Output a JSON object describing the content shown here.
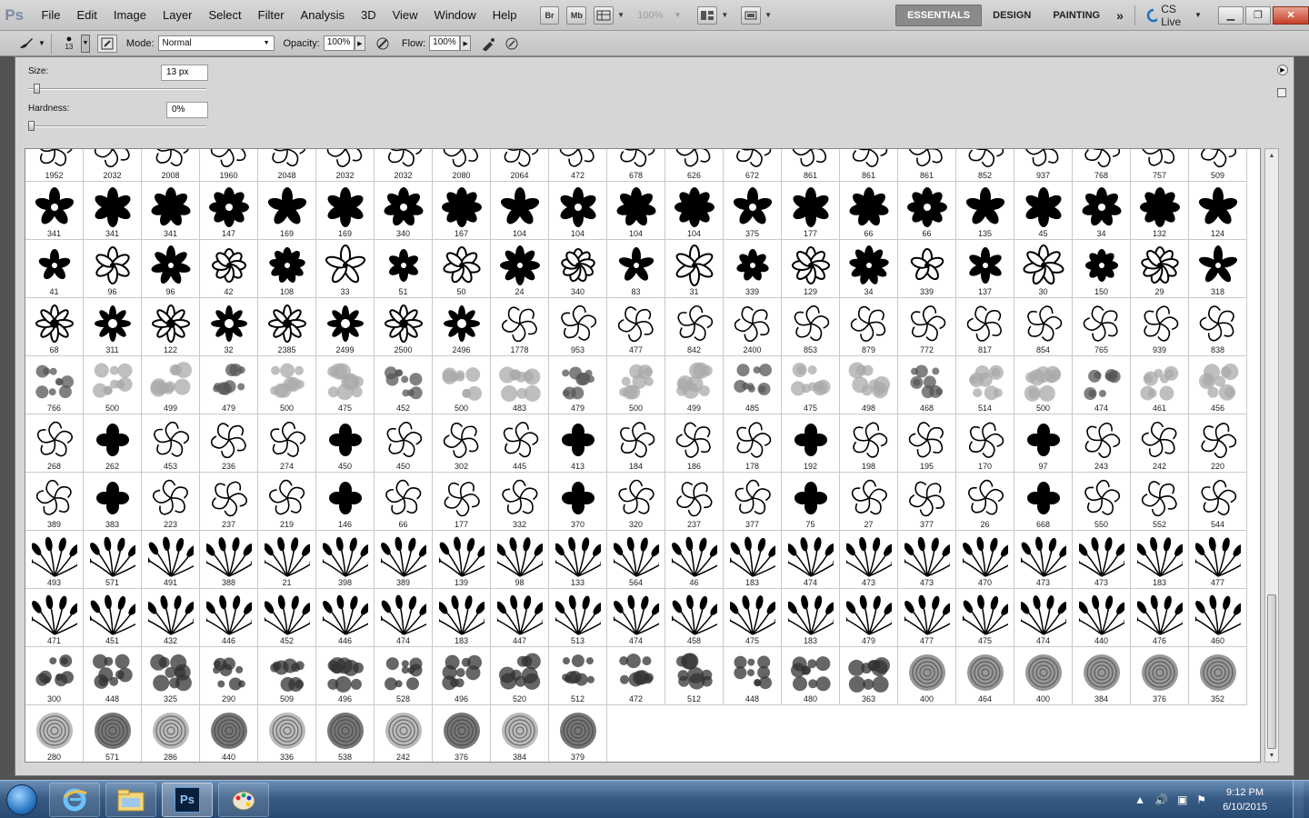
{
  "app": {
    "logo": "Ps"
  },
  "menu": [
    "File",
    "Edit",
    "Image",
    "Layer",
    "Select",
    "Filter",
    "Analysis",
    "3D",
    "View",
    "Window",
    "Help"
  ],
  "menubar_tools": {
    "bridge": "Br",
    "minibridge": "Mb",
    "zoom": "100%"
  },
  "workspaces": {
    "active": "ESSENTIALS",
    "items": [
      "ESSENTIALS",
      "DESIGN",
      "PAINTING"
    ]
  },
  "cslive": "CS Live",
  "options": {
    "mode_label": "Mode:",
    "mode_value": "Normal",
    "opacity_label": "Opacity:",
    "opacity_value": "100%",
    "flow_label": "Flow:",
    "flow_value": "100%",
    "brush_size_badge": "13"
  },
  "brush_panel": {
    "size_label": "Size:",
    "size_value": "13 px",
    "size_fraction": 0.03,
    "hardness_label": "Hardness:",
    "hardness_value": "0%",
    "hardness_fraction": 0.0
  },
  "brush_sizes": [
    1952,
    2032,
    2008,
    1960,
    2048,
    2032,
    2032,
    2080,
    2064,
    472,
    678,
    626,
    672,
    861,
    861,
    861,
    852,
    937,
    768,
    757,
    509,
    341,
    341,
    341,
    147,
    169,
    169,
    340,
    167,
    104,
    104,
    104,
    104,
    375,
    177,
    66,
    66,
    135,
    45,
    34,
    132,
    124,
    41,
    96,
    96,
    42,
    108,
    33,
    51,
    50,
    24,
    340,
    83,
    31,
    339,
    129,
    34,
    339,
    137,
    30,
    150,
    29,
    318,
    68,
    311,
    122,
    32,
    2385,
    2499,
    2500,
    2496,
    1778,
    953,
    477,
    842,
    2400,
    853,
    879,
    772,
    817,
    854,
    765,
    939,
    838,
    766,
    500,
    499,
    479,
    500,
    475,
    452,
    500,
    483,
    479,
    500,
    499,
    485,
    475,
    498,
    468,
    514,
    500,
    474,
    461,
    456,
    268,
    262,
    453,
    236,
    274,
    450,
    450,
    302,
    445,
    413,
    184,
    186,
    178,
    192,
    198,
    195,
    170,
    97,
    243,
    242,
    220,
    389,
    383,
    223,
    237,
    219,
    146,
    66,
    177,
    332,
    370,
    320,
    237,
    377,
    75,
    27,
    377,
    26,
    668,
    550,
    552,
    544,
    493,
    571,
    491,
    388,
    21,
    398,
    389,
    139,
    98,
    133,
    564,
    46,
    183,
    474,
    473,
    473,
    470,
    473,
    473,
    183,
    477,
    471,
    451,
    432,
    446,
    452,
    446,
    474,
    183,
    447,
    513,
    474,
    458,
    475,
    183,
    479,
    477,
    475,
    474,
    440,
    476,
    460,
    300,
    448,
    325,
    290,
    509,
    496,
    528,
    496,
    520,
    512,
    472,
    512,
    448,
    480,
    363,
    400,
    464,
    400,
    384,
    376,
    352,
    280,
    571,
    286,
    440,
    336,
    538,
    242,
    376,
    384,
    379
  ],
  "taskbar": {
    "apps": [
      "Windows Explorer",
      "Internet Explorer",
      "Libraries",
      "Photoshop",
      "Paint"
    ],
    "ps_label": "Ps",
    "time": "9:12 PM",
    "date": "6/10/2015"
  },
  "colors": {
    "accent": "#2c78c4",
    "ps_blue": "#0a1f3c",
    "ws_active": "#8a8a8a"
  }
}
